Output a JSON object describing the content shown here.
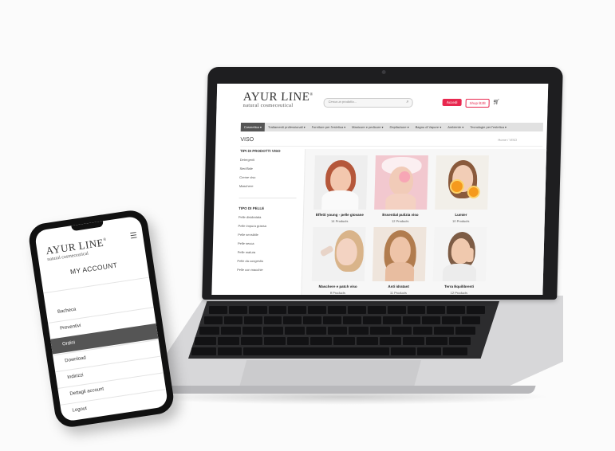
{
  "brand": {
    "name": "AYUR LINE",
    "registered": "®",
    "tagline": "natural cosmeceutical"
  },
  "desktop": {
    "search": {
      "placeholder": "Cerca un prodotto...",
      "icon": "search-icon"
    },
    "buttons": {
      "account": "Accedi",
      "shop": "Shop B2B"
    },
    "nav": [
      {
        "label": "Cosmetica ▾",
        "active": true
      },
      {
        "label": "Trattamenti professionali ▾",
        "active": false
      },
      {
        "label": "Forniture per l'estetica ▾",
        "active": false
      },
      {
        "label": "Manicure e pedicure ▾",
        "active": false
      },
      {
        "label": "Depilazione ▾",
        "active": false
      },
      {
        "label": "Bagno di Vapore ▾",
        "active": false
      },
      {
        "label": "Ambiente ▾",
        "active": false
      },
      {
        "label": "Tecnologie per l'estetica ▾",
        "active": false
      }
    ],
    "page_title": "VISO",
    "breadcrumb": "Home / VISO",
    "sidebar": {
      "section1_title": "TIPI DI PRODOTTI VISO",
      "section1_items": [
        "Detergenti",
        "Sieri/fiale",
        "Creme viso",
        "Maschere"
      ],
      "section2_title": "TIPO DI PELLE",
      "section2_items": [
        "Pelle disidratata",
        "Pelle impura grassa",
        "Pelle sensibile",
        "Pelle secca",
        "Pelle matura",
        "Pelle da congestio",
        "Pelle con macchie"
      ]
    },
    "products": [
      {
        "name": "Effetti young - pelle giovane",
        "count": "14 Products"
      },
      {
        "name": "Essential pulizia viso",
        "count": "12 Products"
      },
      {
        "name": "Lumier",
        "count": "10 Products"
      },
      {
        "name": "Maschere e patch viso",
        "count": "9 Products"
      },
      {
        "name": "Anti idratant",
        "count": "11 Products"
      },
      {
        "name": "Terra Equilibrenti",
        "count": "12 Products"
      }
    ]
  },
  "mobile": {
    "title": "MY ACCOUNT",
    "menu": [
      {
        "label": "Bacheca",
        "active": false
      },
      {
        "label": "Preventivi",
        "active": false
      },
      {
        "label": "Ordini",
        "active": true
      },
      {
        "label": "Download",
        "active": false
      },
      {
        "label": "Indirizzi",
        "active": false
      },
      {
        "label": "Dettagli account",
        "active": false
      },
      {
        "label": "Logout",
        "active": false
      }
    ]
  },
  "colors": {
    "accent": "#e8284f",
    "nav_active": "#555555",
    "laptop_body": "#1e1e20",
    "deck": "#d7d7d9"
  }
}
